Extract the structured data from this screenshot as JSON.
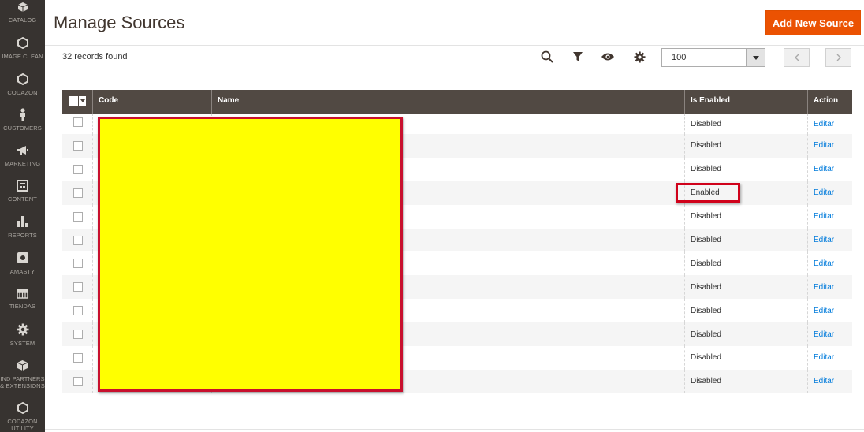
{
  "sidebar": {
    "items": [
      {
        "label": "CATALOG",
        "icon": "catalog-icon"
      },
      {
        "label": "IMAGE CLEAN",
        "icon": "hexagon-icon"
      },
      {
        "label": "CODAZON",
        "icon": "hexagon-icon"
      },
      {
        "label": "CUSTOMERS",
        "icon": "customers-icon"
      },
      {
        "label": "MARKETING",
        "icon": "megaphone-icon"
      },
      {
        "label": "CONTENT",
        "icon": "content-icon"
      },
      {
        "label": "REPORTS",
        "icon": "bar-chart-icon"
      },
      {
        "label": "AMASTY",
        "icon": "amasty-icon"
      },
      {
        "label": "TIENDAS",
        "icon": "store-icon"
      },
      {
        "label": "SYSTEM",
        "icon": "gear-icon"
      },
      {
        "label": "IND PARTNERS\n& EXTENSIONS",
        "icon": "partners-icon"
      },
      {
        "label": "CODAZON\nUTILITY",
        "icon": "hexagon-icon"
      }
    ]
  },
  "header": {
    "title": "Manage Sources",
    "add_button": "Add New Source"
  },
  "toolbar": {
    "records_found": "32 records found",
    "per_page": "100",
    "icons": [
      "search-icon",
      "filter-icon",
      "eye-icon",
      "gear-icon"
    ]
  },
  "grid": {
    "columns": {
      "code": "Code",
      "name": "Name",
      "is_enabled": "Is Enabled",
      "action": "Action"
    },
    "rows": [
      {
        "status": "Disabled",
        "action": "Editar"
      },
      {
        "status": "Disabled",
        "action": "Editar"
      },
      {
        "status": "Disabled",
        "action": "Editar"
      },
      {
        "status": "Enabled",
        "action": "Editar"
      },
      {
        "status": "Disabled",
        "action": "Editar"
      },
      {
        "status": "Disabled",
        "action": "Editar"
      },
      {
        "status": "Disabled",
        "action": "Editar"
      },
      {
        "status": "Disabled",
        "action": "Editar"
      },
      {
        "status": "Disabled",
        "action": "Editar"
      },
      {
        "status": "Disabled",
        "action": "Editar"
      },
      {
        "status": "Disabled",
        "action": "Editar"
      },
      {
        "status": "Disabled",
        "action": "Editar"
      }
    ]
  },
  "colors": {
    "sidebar_bg": "#373330",
    "accent": "#eb5202",
    "grid_header": "#514943",
    "link": "#007bdb",
    "redaction_fill": "#ffff00",
    "highlight_border": "#d0021b"
  }
}
